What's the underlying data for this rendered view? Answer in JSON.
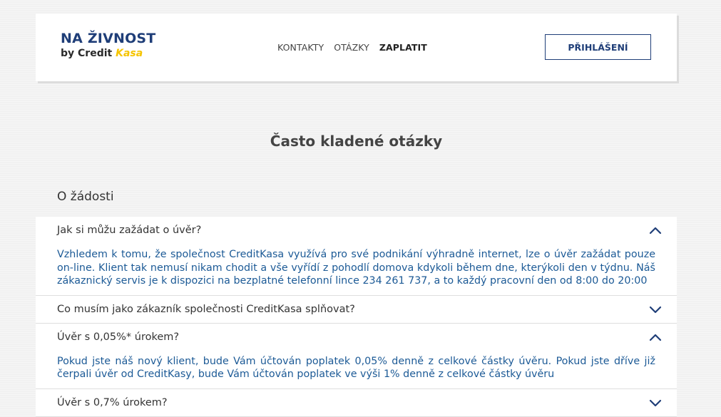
{
  "header": {
    "logo_line1": "NA ŽIVNOST",
    "logo_by": "by Credit ",
    "logo_kasa": "Kasa",
    "nav": [
      "KONTAKTY",
      "OTÁZKY",
      "ZAPLATIT"
    ],
    "login_label": "PŘIHLÁŠENÍ"
  },
  "main": {
    "title": "Často kladené otázky",
    "section": "O žádosti",
    "faq": [
      {
        "question": "Jak si můžu zažádat o úvěr?",
        "answer": "Vzhledem k tomu, že společnost CreditKasa využívá pro své podnikání výhradně internet, lze o úvěr zažádat pouze on-line. Klient tak nemusí nikam chodit a vše vyřídí z pohodlí domova kdykoli během dne, kterýkoli den v týdnu. Náš zákaznický servis je k dispozici na bezplatné telefonní lince 234 261 737, a to každý pracovní den od 8:00 do 20:00",
        "expanded": true
      },
      {
        "question": "Co musím jako zákazník společnosti CreditKasa splňovat?",
        "expanded": false
      },
      {
        "question": "Úvěr s 0,05%* úrokem?",
        "answer": "Pokud jste náš nový klient, bude Vám účtován poplatek 0,05% denně z celkové částky úvěru. Pokud jste dříve již čerpali úvěr od CreditKasy, bude Vám účtován poplatek ve výši 1% denně z celkové částky úvěru",
        "expanded": true
      },
      {
        "question": "Úvěr s 0,7% úrokem?",
        "expanded": false
      }
    ]
  },
  "colors": {
    "brand_blue": "#1f3e78",
    "answer_blue": "#1c5a96",
    "kasa_yellow": "#f5c400"
  },
  "icons": {
    "expanded": "chevron-up-icon",
    "collapsed": "chevron-down-icon"
  }
}
